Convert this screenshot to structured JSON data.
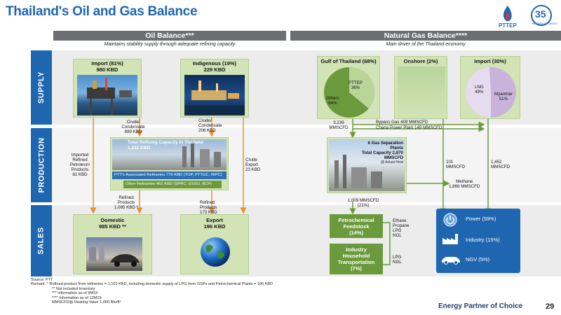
{
  "title": "Thailand's Oil and Gas Balance",
  "logo_text": "PTTEP",
  "logo_anniversary": "35",
  "logo_sub": "PARTNER OF CHOICE",
  "oil_header": "Oil Balance***",
  "gas_header": "Natural Gas Balance****",
  "oil_subtitle": "Maintains stability supply through adequate refining capacity",
  "gas_subtitle": "Main driver of the Thailand economy",
  "rows": {
    "supply": "SUPPLY",
    "production": "PRODUCTION",
    "sales": "SALES"
  },
  "oil": {
    "import_box": {
      "line1": "Import (81%)",
      "line2": "980 KBD"
    },
    "indigenous_box": {
      "line1": "Indigenous (19%)",
      "line2": "229 KBD"
    },
    "crude_left": {
      "line1": "Crude/",
      "line2": "Condensate",
      "line3": "899 KBD"
    },
    "crude_right": {
      "line1": "Crude/",
      "line2": "Condensate",
      "line3": "206 KBD"
    },
    "imported_refined": {
      "line1": "Imported",
      "line2": "Refined",
      "line3": "Petroleum",
      "line4": "Products",
      "line5": "81 KBD"
    },
    "crude_export": {
      "line1": "Crude",
      "line2": "Export",
      "line3": "23 KBD"
    },
    "refining": {
      "line1": "Total Refining Capacity in Thailand",
      "line2": "1,232 KBD"
    },
    "ptt_refineries": "PTT's Associated Refineries 770 KBD (TOP, PTTGC, IRPC)",
    "other_refineries": "Other Refineries 462 KBD (SPRC, ESSO, BCP)",
    "refined_left": {
      "line1": "Refined",
      "line2": "Products",
      "line3": "1,095 KBD *"
    },
    "refined_right": {
      "line1": "Refined",
      "line2": "Products",
      "line3": "173 KBD"
    },
    "domestic_box": {
      "line1": "Domestic",
      "line2": "985 KBD **"
    },
    "export_box": {
      "line1": "Export",
      "line2": "196 KBD"
    }
  },
  "gas": {
    "gulf": {
      "title": "Gulf of Thailand (68%)",
      "slice1_label": "PTTEP",
      "slice1_value": "36%",
      "slice2_label": "Others",
      "slice2_value": "64%"
    },
    "onshore": {
      "title": "Onshore (2%)"
    },
    "import": {
      "title": "Import (30%)",
      "slice1_label": "LNG",
      "slice1_value": "49%",
      "slice2_label": "Myanmar",
      "slice2_value": "51%"
    },
    "gulf_flow": {
      "line1": "3,239",
      "line2": "MMSCFD"
    },
    "bypass": "Bypass Gas 409 MMSCFD",
    "chana": "Chana Power Plant 149 MMSCFD",
    "gsp": {
      "line1": "6 Gas Separation Plants",
      "line2": "Total Capacity 2,870 MMSCFD",
      "line3": "@ Actual Heat"
    },
    "import_flow_left": {
      "line1": "101",
      "line2": "MMSCFD"
    },
    "import_flow_right": {
      "line1": "1,452",
      "line2": "MMSCFD"
    },
    "methane": {
      "line1": "Methane",
      "line2": "1,866 MMSCFD"
    },
    "gsp_out": {
      "line1": "1,009 MMSCFD",
      "line2": "(21%)"
    },
    "petrochem": {
      "line1": "Petrochemical",
      "line2": "Feedstock",
      "line3": "(14%)"
    },
    "industry_transport": {
      "line1": "Industry",
      "line2": "Household",
      "line3": "Transportation",
      "line4": "(7%)"
    },
    "ethane": {
      "line1": "Ethane",
      "line2": "Propane",
      "line3": "LPG",
      "line4": "NGL"
    },
    "lpg": {
      "line1": "LPG",
      "line2": "NGL"
    },
    "power": "Power (59%)",
    "industry": "Industry (15%)",
    "ngv": "NGV (5%)"
  },
  "footer": {
    "source": "Source: PTT",
    "remark1": "Remark: *     Refined product from refineries  = 1,102 KBD, including domestic supply of LPG from GSPs and Petrochemical Plants = 106 KBD",
    "remark2": "**   Not included Inventory",
    "remark3": "***  Information as of 9M19",
    "remark4": "**** Information as of 12M19",
    "remark5": "MMSCFD@ Heating Value 1,000 Btu/ft³",
    "tagline": "Energy Partner of Choice",
    "page": "29"
  },
  "colors": {
    "blue": "#1f66b0",
    "green": "#6b9a3c",
    "lightgreen": "#d2e3b6",
    "gray": "#6d6e71",
    "arrow": "#e8912d",
    "gas_arrow": "#6b9a3c"
  },
  "pie_shares": {
    "gulf_pttep": 36,
    "import_lng": 49
  }
}
